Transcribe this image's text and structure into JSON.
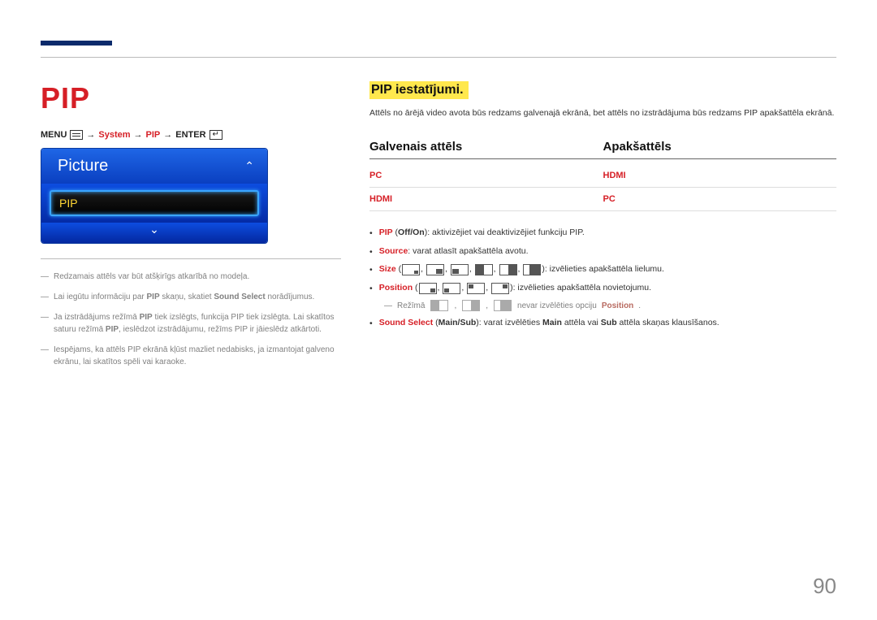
{
  "page_number": "90",
  "left": {
    "title": "PIP",
    "menu_path": {
      "menu": "MENU",
      "system": "System",
      "pip": "PIP",
      "enter": "ENTER",
      "arrow": "→"
    },
    "osd": {
      "header": "Picture",
      "item": "PIP"
    },
    "notes": [
      {
        "text": "Redzamais attēls var būt atšķirīgs atkarībā no modeļa."
      },
      {
        "prefix": "Lai iegūtu informāciju par ",
        "kw": "PIP",
        "mid": " skaņu, skatiet ",
        "kw2": "Sound Select",
        "suffix": " norādījumus."
      },
      {
        "prefix": "Ja izstrādājums režīmā ",
        "kw": "PIP",
        "mid": " tiek izslēgts, funkcija PIP tiek izslēgta. Lai skatītos saturu režīmā ",
        "kw2": "PIP",
        "suffix": ", ieslēdzot izstrādājumu, režīms PIP ir jāieslēdz atkārtoti."
      },
      {
        "text": "Iespējams, ka attēls PIP ekrānā kļūst mazliet nedabisks, ja izmantojat galveno ekrānu, lai skatītos spēli vai karaoke."
      }
    ]
  },
  "right": {
    "section_title": "PIP iestatījumi.",
    "intro": "Attēls no ārējā video avota būs redzams galvenajā ekrānā, bet attēls no izstrādājuma būs redzams PIP apakšattēla ekrānā.",
    "table": {
      "header_main": "Galvenais attēls",
      "header_sub": "Apakšattēls",
      "rows": [
        {
          "main": "PC",
          "sub": "HDMI"
        },
        {
          "main": "HDMI",
          "sub": "PC"
        }
      ]
    },
    "bullets": {
      "pip": {
        "kw": "PIP",
        "paren": " (",
        "opt": "Off/On",
        "rest": "): aktivizējiet vai deaktivizējiet funkciju PIP."
      },
      "source": {
        "kw": "Source",
        "rest": ": varat atlasīt apakšattēla avotu."
      },
      "size": {
        "kw": "Size",
        "rest": ": izvēlieties apakšattēla lielumu."
      },
      "position": {
        "kw": "Position",
        "rest": ": izvēlieties apakšattēla novietojumu."
      },
      "position_note": {
        "pre": "Režīmā ",
        "mid": " nevar izvēlēties opciju ",
        "kw": "Position",
        "end": "."
      },
      "sound": {
        "kw": "Sound Select",
        "paren": " (",
        "opt": "Main/Sub",
        "mid": "): varat izvēlēties ",
        "main": "Main",
        "mid2": " attēla vai ",
        "sub": "Sub",
        "end": " attēla skaņas klausīšanos."
      }
    }
  }
}
